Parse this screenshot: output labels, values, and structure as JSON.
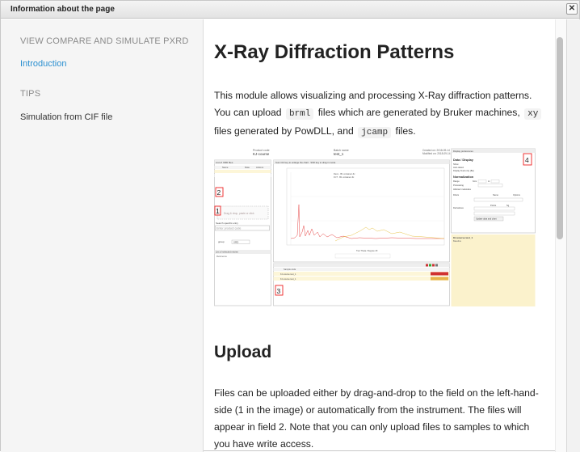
{
  "window": {
    "title": "Information about the page",
    "close_glyph": "✕"
  },
  "sidebar": {
    "sections": [
      {
        "heading": "VIEW COMPARE AND SIMULATE PXRD",
        "items": [
          {
            "label": "Introduction",
            "active": true
          }
        ]
      },
      {
        "heading": "TIPS",
        "items": [
          {
            "label": "Simulation from CIF file",
            "active": false
          }
        ]
      }
    ]
  },
  "content": {
    "title": "X-Ray Diffraction Patterns",
    "intro": {
      "t1": "This module allows visualizing and processing X-Ray diffraction patterns. You can upload ",
      "c1": "brml",
      "t2": " files which are generated by Bruker machines, ",
      "c2": "xy",
      "t3": " files generated by PowDLL, and ",
      "c3": "jcamp",
      "t4": " files."
    },
    "figure": {
      "header_left_label": "Product code",
      "header_left_value": "KJ-course",
      "header_mid_label": "Batch name",
      "header_mid_value": "test_1",
      "header_right_1": "Created on: 2018-09-14",
      "header_right_2": "Modified on: 2018-09-14",
      "list_title": "List of XRD files",
      "list_col_name": "Name",
      "list_col_date": "Date",
      "list_col_action": "Actions",
      "drop_hint": "Drag & drop, paste or click",
      "search_title": "Search specific entry",
      "search_placeholder": "Enter product code",
      "group_label": "group",
      "group_value": "XRD",
      "selected_title": "List of selected entries",
      "selected_col": "Reference",
      "chart_title": "Sum  Ctrl key to enlarge the chart · Shift key to drag in mode",
      "chart_legend_1": "Dens · B1 container-fix",
      "chart_legend_2": "FCT · B1 container-fix",
      "chart_xlabel": "Two Theta / Degree 2θ",
      "table_col_name": "Sample code",
      "table_row_1": "KJ-course test_1",
      "table_row_2": "KJ-course test_1",
      "settings_title": "Display preferences",
      "data_display": "Data / Display",
      "opt_1": "Show",
      "opt_2": "Auto detect",
      "opt_3": "Display fixed only (Be)",
      "normalization": "Normalization",
      "range": "Range",
      "from_label": "from",
      "to_label": "to",
      "processing": "Processing",
      "abstract": "Abstract molecules",
      "filters": "Filters",
      "name_label": "Name",
      "options_label": "Options",
      "deviation": "Derivatives",
      "points_label": "Points",
      "sg_label": "Sg",
      "update_btn": "Update data and chart",
      "info_title": "KJ-course test_1",
      "info_sub": "Baseline",
      "markers": [
        "1",
        "2",
        "3",
        "4"
      ]
    },
    "upload_title": "Upload",
    "upload_text": "Files can be uploaded either by drag-and-drop to the field on the left-hand-side (1 in the image) or automatically from the instrument. The files will appear in field 2. Note that you can only upload files to samples to which you have write access."
  }
}
